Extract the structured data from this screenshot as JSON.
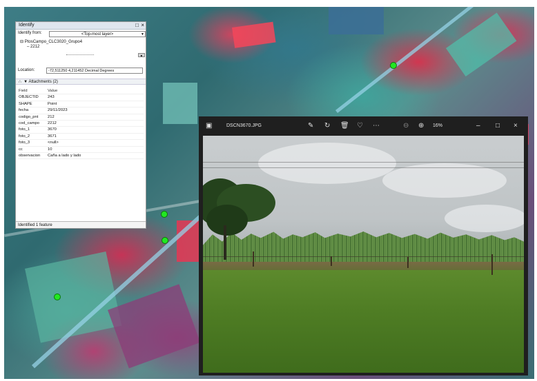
{
  "identify": {
    "title": "Identify",
    "identify_from_label": "Identify from:",
    "identify_from_value": "<Top-most layer>",
    "layer_name": "PtosCampo_CLC3020_Grupo4",
    "feature_id": "2212",
    "location_label": "Location:",
    "location_value": "-72,511250  4,211452 Decimal Degrees",
    "attachments_label": "Attachments (2)",
    "header": {
      "field": "Field",
      "value": "Value"
    },
    "rows": [
      {
        "field": "OBJECTID",
        "value": "243"
      },
      {
        "field": "SHAPE",
        "value": "Point"
      },
      {
        "field": "fecha",
        "value": "29/11/2023"
      },
      {
        "field": "codigo_pnt",
        "value": "212"
      },
      {
        "field": "cod_campo",
        "value": "2212"
      },
      {
        "field": "foto_1",
        "value": "3670"
      },
      {
        "field": "foto_2",
        "value": "3671"
      },
      {
        "field": "foto_3",
        "value": "<null>"
      },
      {
        "field": "cc",
        "value": "10"
      },
      {
        "field": "observacion",
        "value": "Caña a lado y lado"
      }
    ],
    "status": "Identified 1 feature"
  },
  "viewer": {
    "filename": "DSCN3670.JPG",
    "zoom": "16%",
    "icons": [
      "image-icon",
      "edit-icon",
      "rotate-icon",
      "delete-icon",
      "heart-icon",
      "more-icon",
      "zoom-out-icon",
      "zoom-in-icon",
      "minimize-icon",
      "maximize-icon",
      "close-icon"
    ]
  },
  "colors": {
    "gps_point": "#22e822",
    "viewer_bg": "#1f1f1f"
  }
}
